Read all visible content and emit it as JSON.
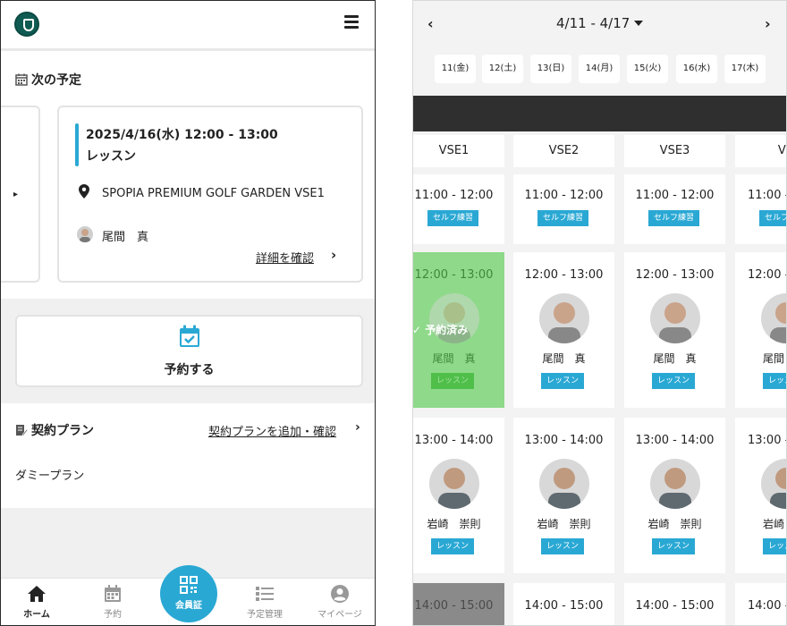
{
  "left": {
    "header": {
      "logo": "club-logo-icon",
      "menu": "hamburger-icon"
    },
    "schedule": {
      "section_title": "次の予定",
      "date_time": "2025/4/16(水) 12:00 - 13:00",
      "type": "レッスン",
      "place": "SPOPIA PREMIUM GOLF GARDEN VSE1",
      "coach": "尾間　真",
      "detail_link": "詳細を確認"
    },
    "reserve": {
      "label": "予約する"
    },
    "plan": {
      "section_title": "契約プラン",
      "link": "契約プランを追加・確認",
      "plan_name": "ダミープラン"
    },
    "tabs": [
      {
        "label": "ホーム",
        "icon": "home-icon"
      },
      {
        "label": "予約",
        "icon": "calendar-icon"
      },
      {
        "label": "会員証",
        "icon": "qr-code-icon"
      },
      {
        "label": "予定管理",
        "icon": "list-icon"
      },
      {
        "label": "マイページ",
        "icon": "user-circle-icon"
      }
    ]
  },
  "right": {
    "week_label": "4/11 - 4/17",
    "days": [
      "11(金)",
      "12(土)",
      "13(日)",
      "14(月)",
      "15(火)",
      "16(水)",
      "17(木)"
    ],
    "columns": [
      "VSE1",
      "VSE2",
      "VSE3",
      "VS"
    ],
    "booked_label": "予約済み",
    "rows": [
      {
        "time": "11:00 - 12:00",
        "tag": "セルフ練習",
        "coach": ""
      },
      {
        "time": "12:00 - 13:00",
        "tag": "レッスン",
        "coach": "尾間　真"
      },
      {
        "time": "13:00 - 14:00",
        "tag": "レッスン",
        "coach": "岩崎　崇則"
      },
      {
        "time": "14:00 - 15:00",
        "tag": "",
        "coach": ""
      }
    ],
    "colors": {
      "accent": "#2aa8d4",
      "booked": "#8fd98a",
      "dark_band": "#2f2f2f"
    }
  }
}
